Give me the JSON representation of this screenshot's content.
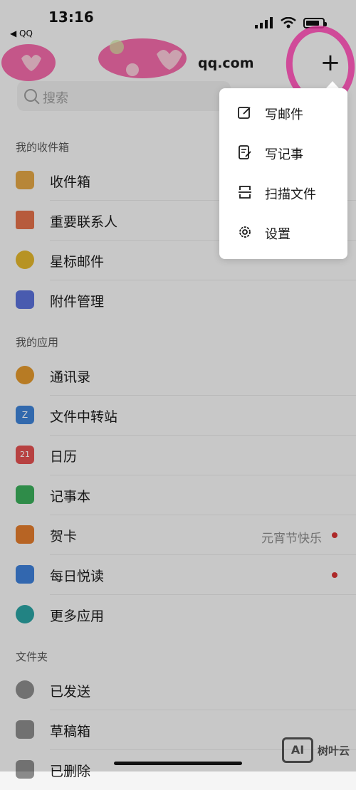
{
  "status": {
    "time": "13:16",
    "back_app": "◀ QQ"
  },
  "header": {
    "account_suffix": "qq.com",
    "add_icon": "plus-icon"
  },
  "search": {
    "placeholder": "搜索"
  },
  "sections": {
    "inbox_title": "我的收件箱",
    "apps_title": "我的应用",
    "folders_title": "文件夹"
  },
  "inbox_items": [
    {
      "label": "收件箱",
      "icon": "inbox-icon",
      "color": "#e0a445"
    },
    {
      "label": "重要联系人",
      "icon": "bookmark-icon",
      "color": "#e0704a"
    },
    {
      "label": "星标邮件",
      "icon": "star-icon",
      "color": "#e0b42c"
    },
    {
      "label": "附件管理",
      "icon": "attachment-icon",
      "color": "#5a6fd6"
    }
  ],
  "app_items": [
    {
      "label": "通讯录",
      "icon": "contacts-icon",
      "color": "#e0962c"
    },
    {
      "label": "文件中转站",
      "icon": "transfer-folder-icon",
      "color": "#3e80d4",
      "glyph": "Z"
    },
    {
      "label": "日历",
      "icon": "calendar-icon",
      "color": "#e05050",
      "glyph": "21"
    },
    {
      "label": "记事本",
      "icon": "notebook-icon",
      "color": "#3aab5a"
    },
    {
      "label": "贺卡",
      "icon": "greeting-card-icon",
      "color": "#e07a2c",
      "extra": "元宵节快乐",
      "dot": true
    },
    {
      "label": "每日悦读",
      "icon": "daily-reading-icon",
      "color": "#3e7ed6",
      "dot": true
    },
    {
      "label": "更多应用",
      "icon": "more-apps-icon",
      "color": "#2aa0a0"
    }
  ],
  "folder_items": [
    {
      "label": "已发送",
      "icon": "sent-icon",
      "color": "#8a8a8a"
    },
    {
      "label": "草稿箱",
      "icon": "drafts-icon",
      "color": "#8a8a8a"
    },
    {
      "label": "已删除",
      "icon": "trash-icon",
      "color": "#8a8a8a"
    }
  ],
  "popup_menu": [
    {
      "label": "写邮件",
      "icon": "compose-icon"
    },
    {
      "label": "写记事",
      "icon": "write-note-icon"
    },
    {
      "label": "扫描文件",
      "icon": "scan-document-icon"
    },
    {
      "label": "设置",
      "icon": "settings-gear-icon"
    }
  ],
  "watermark": {
    "box": "AI",
    "text": "树叶云"
  },
  "colors": {
    "accent_circle": "#ff3fb0",
    "badge_dot": "#d43333"
  }
}
